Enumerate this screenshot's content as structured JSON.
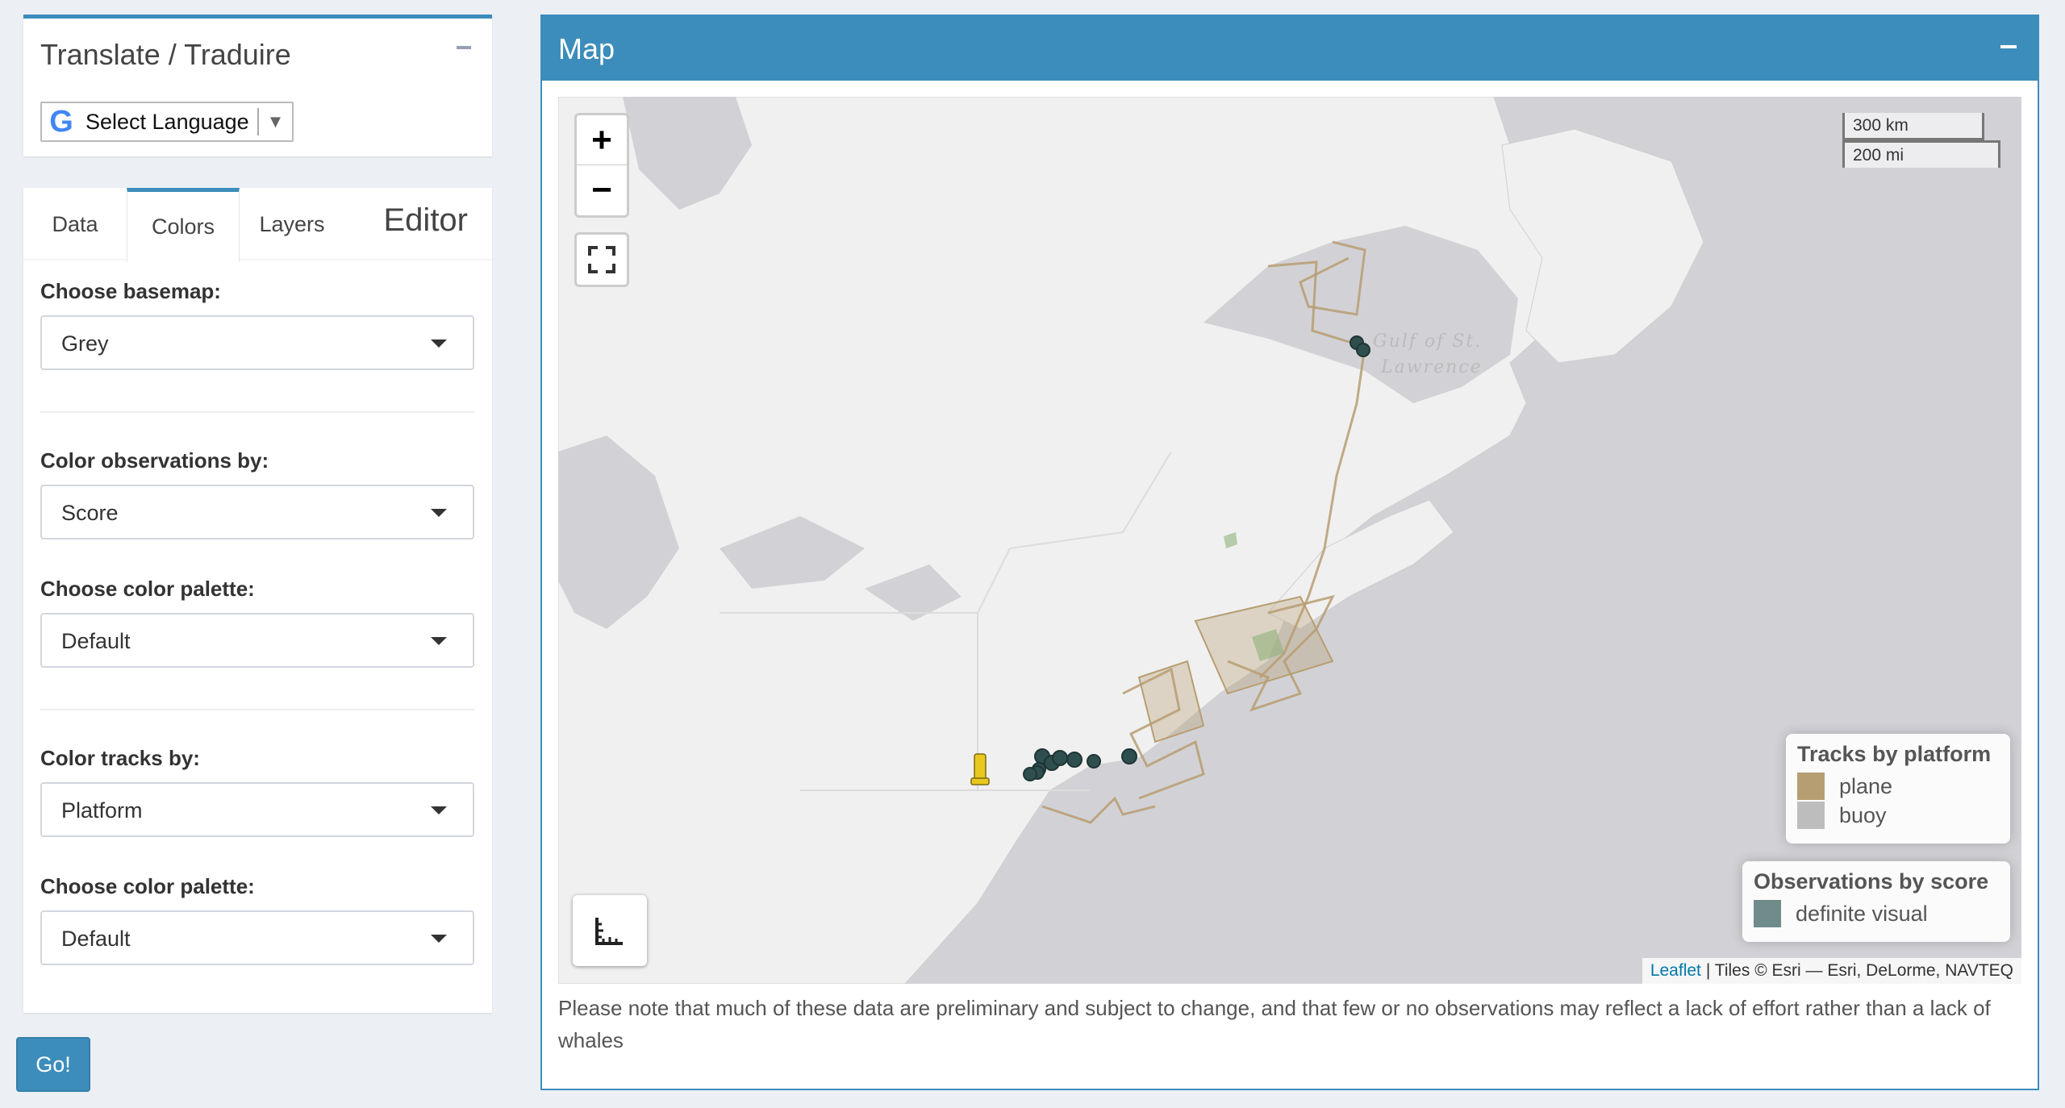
{
  "translate": {
    "title": "Translate / Traduire",
    "language_select_label": "Select Language",
    "google_icon": "G"
  },
  "editor": {
    "tabs": [
      {
        "label": "Data"
      },
      {
        "label": "Colors"
      },
      {
        "label": "Layers"
      }
    ],
    "title": "Editor",
    "active_tab": "Colors",
    "fields": {
      "basemap": {
        "label": "Choose basemap:",
        "value": "Grey"
      },
      "obs_color_by": {
        "label": "Color observations by:",
        "value": "Score"
      },
      "obs_palette": {
        "label": "Choose color palette:",
        "value": "Default"
      },
      "tracks_color_by": {
        "label": "Color tracks by:",
        "value": "Platform"
      },
      "tracks_palette": {
        "label": "Choose color palette:",
        "value": "Default"
      }
    }
  },
  "go_button": {
    "label": "Go!"
  },
  "map": {
    "title": "Map",
    "zoom_in": "+",
    "zoom_out": "−",
    "scale": {
      "km": "300 km",
      "mi": "200 mi"
    },
    "region_label_1": "Gulf of St.",
    "region_label_2": "Lawrence",
    "tracks_legend": {
      "title": "Tracks by platform",
      "items": [
        {
          "label": "plane",
          "color": "#b79e72"
        },
        {
          "label": "buoy",
          "color": "#bdbdbd"
        }
      ]
    },
    "obs_legend": {
      "title": "Observations by score",
      "items": [
        {
          "label": "definite visual",
          "color": "#6f8b8a"
        }
      ]
    },
    "attribution": {
      "leaflet": "Leaflet",
      "rest": "| Tiles © Esri — Esri, DeLorme, NAVTEQ"
    },
    "note": "Please note that much of these data are preliminary and subject to change, and that few or no observations may reflect a lack of effort rather than a lack of whales"
  },
  "colors": {
    "accent": "#3c8dbc",
    "land": "#f0f0f0",
    "water": "#d2d2d6",
    "track_plane": "#b79e72",
    "observation_dot": "#2f4f4f",
    "buoy": "#e8c81e"
  }
}
